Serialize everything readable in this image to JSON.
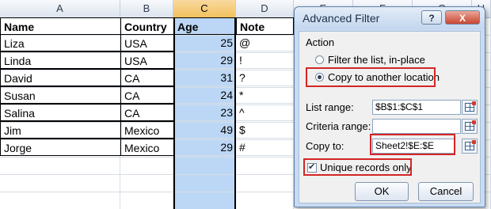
{
  "spreadsheet": {
    "column_headers": [
      "A",
      "B",
      "C",
      "D",
      "E",
      "F",
      "G",
      "H"
    ],
    "selected_column": "C",
    "table_headers": [
      "Name",
      "Country",
      "Age",
      "Note"
    ],
    "rows": [
      [
        "Liza",
        "USA",
        "25",
        "@"
      ],
      [
        "Linda",
        "USA",
        "29",
        "!"
      ],
      [
        "David",
        "CA",
        "31",
        "?"
      ],
      [
        "Susan",
        "CA",
        "24",
        "*"
      ],
      [
        "Salina",
        "CA",
        "23",
        "^"
      ],
      [
        "Jim",
        "Mexico",
        "49",
        "$"
      ],
      [
        "Jorge",
        "Mexico",
        "29",
        "#"
      ]
    ]
  },
  "dialog": {
    "title": "Advanced Filter",
    "help_label": "?",
    "close_label": "X",
    "action_label": "Action",
    "radio_filter_label": "Filter the list, in-place",
    "radio_copy_label": "Copy to another location",
    "list_range_label": "List range:",
    "list_range_value": "$B$1:$C$1",
    "criteria_range_label": "Criteria range:",
    "criteria_range_value": "",
    "copy_to_label": "Copy to:",
    "copy_to_value": "Sheet2!$E:$E",
    "unique_label": "Unique records only",
    "ok_label": "OK",
    "cancel_label": "Cancel",
    "selected_action": "copy",
    "unique_checked": true,
    "accent_color": "#d42525"
  }
}
